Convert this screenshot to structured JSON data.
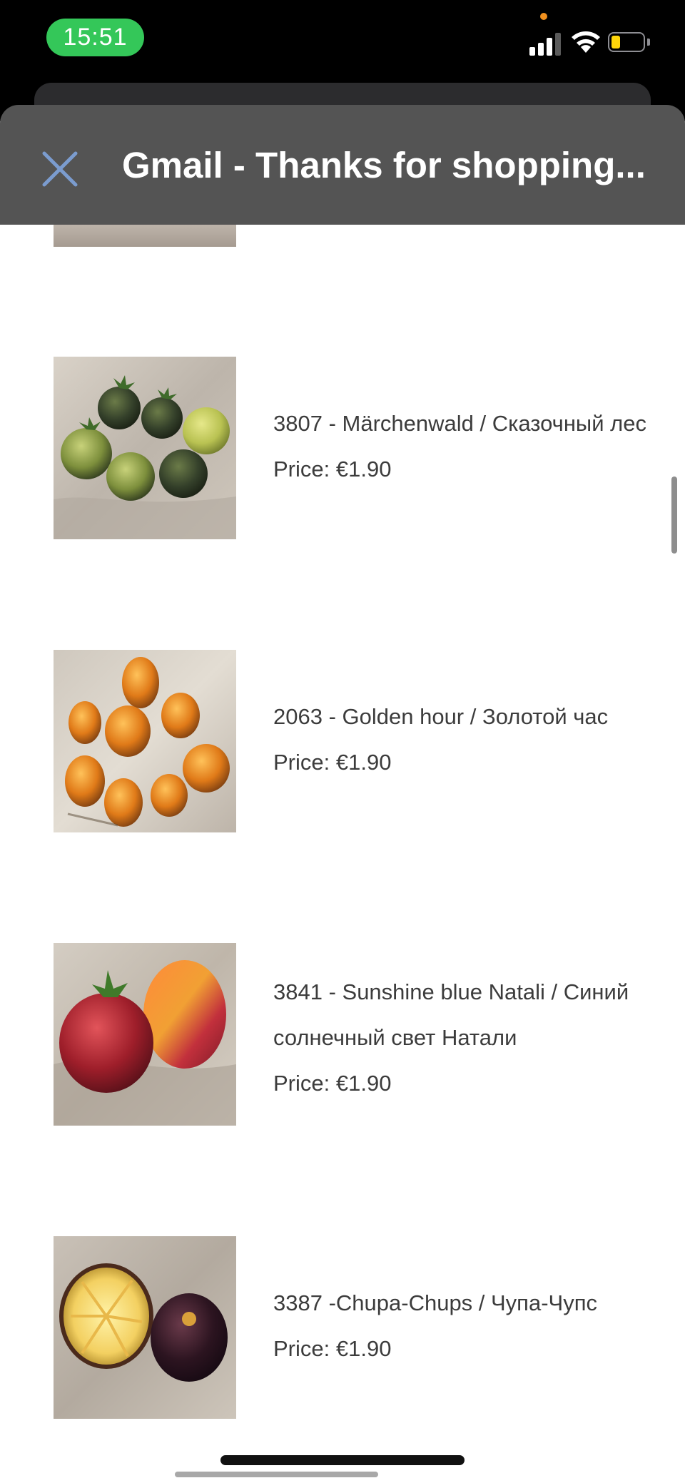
{
  "status_bar": {
    "time": "15:51",
    "signal_icon": "cellular-signal-icon",
    "wifi_icon": "wifi-icon",
    "battery_icon": "battery-low-icon",
    "time_pill_color": "#34c759",
    "battery_color": "#ffd60a"
  },
  "header": {
    "title": "Gmail - Thanks for shopping...",
    "close_icon": "close-icon",
    "background": "#545454",
    "close_color": "#7b9ccf"
  },
  "products": [
    {
      "lines": [
        "3807 - Märchenwald / Сказочный лес"
      ],
      "price": "Price: €1.90",
      "image": "green-dark-tomatoes-photo"
    },
    {
      "lines": [
        "2063 - Golden hour / Золотой час"
      ],
      "price": "Price: €1.90",
      "image": "orange-striped-tomatoes-photo"
    },
    {
      "lines": [
        "3841 - Sunshine blue Natali / Синий",
        "солнечный свет Натали"
      ],
      "price": "Price: €1.90",
      "image": "red-bicolor-tomatoes-photo"
    },
    {
      "lines": [
        "3387 -Chupa-Chups / Чупа-Чупс"
      ],
      "price": "Price: €1.90",
      "image": "yellow-and-black-tomato-photo"
    }
  ]
}
